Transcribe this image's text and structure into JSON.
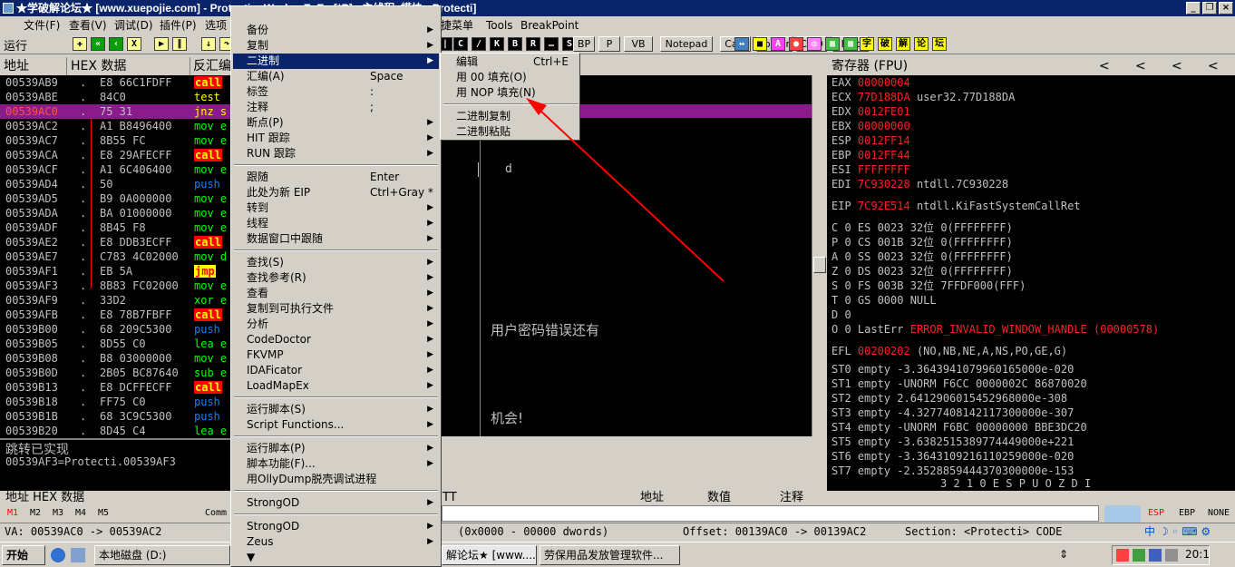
{
  "titlebar": {
    "title": "★学破解论坛★ [www.xuepojie.com] - ProtectionWorker.ExE - [*P] - 主线程, 模块 - Protecti]"
  },
  "menubar": [
    "文件(F)",
    "查看(V)",
    "调试(D)",
    "插件(P)",
    "选项",
    "捷菜单",
    "Tools",
    "BreakPoint"
  ],
  "toolbar": {
    "run_label": "运行",
    "buttons": [
      "BP",
      "P",
      "VB",
      "Notepad",
      "Calc",
      "Folder",
      "CMD",
      "Exit"
    ],
    "icons_right": [
      "破",
      "解",
      "论",
      "坛"
    ]
  },
  "cpu": {
    "headers": [
      "地址",
      "HEX 数据",
      "反汇编"
    ],
    "rows": [
      {
        "addr": "00539AB9",
        "hex": "E8 66C1FDFF",
        "mn": "call",
        "cls": "call",
        "rest": ""
      },
      {
        "addr": "00539ABE",
        "hex": "84C0",
        "mn": "test",
        "cls": "test",
        "rest": ""
      },
      {
        "addr": "00539AC0",
        "hex": "75 31",
        "mn": "jnz s",
        "cls": "jnz",
        "rest": ""
      },
      {
        "addr": "00539AC2",
        "hex": "A1 B8496400",
        "mn": "mov e",
        "cls": "mov",
        "rest": ""
      },
      {
        "addr": "00539AC7",
        "hex": "8B55 FC",
        "mn": "mov e",
        "cls": "mov",
        "rest": ""
      },
      {
        "addr": "00539ACA",
        "hex": "E8 29AFECFF",
        "mn": "call",
        "cls": "call",
        "rest": ""
      },
      {
        "addr": "00539ACF",
        "hex": "A1 6C406400",
        "mn": "mov e",
        "cls": "mov",
        "rest": ""
      },
      {
        "addr": "00539AD4",
        "hex": "50",
        "mn": "push",
        "cls": "push",
        "rest": ""
      },
      {
        "addr": "00539AD5",
        "hex": "B9 0A000000",
        "mn": "mov e",
        "cls": "mov",
        "rest": ""
      },
      {
        "addr": "00539ADA",
        "hex": "BA 01000000",
        "mn": "mov e",
        "cls": "mov",
        "rest": ""
      },
      {
        "addr": "00539ADF",
        "hex": "8B45 F8",
        "mn": "mov e",
        "cls": "mov",
        "rest": ""
      },
      {
        "addr": "00539AE2",
        "hex": "E8 DDB3ECFF",
        "mn": "call",
        "cls": "call",
        "rest": ""
      },
      {
        "addr": "00539AE7",
        "hex": "C783 4C02000",
        "mn": "mov d",
        "cls": "mov",
        "rest": ""
      },
      {
        "addr": "00539AF1",
        "hex": "EB 5A",
        "mn": "jmp",
        "cls": "jmp",
        "rest": ""
      },
      {
        "addr": "00539AF3",
        "hex": "8B83 FC02000",
        "mn": "mov e",
        "cls": "mov",
        "rest": ""
      },
      {
        "addr": "00539AF9",
        "hex": "33D2",
        "mn": "xor e",
        "cls": "xor",
        "rest": ""
      },
      {
        "addr": "00539AFB",
        "hex": "E8 78B7FBFF",
        "mn": "call",
        "cls": "call",
        "rest": ""
      },
      {
        "addr": "00539B00",
        "hex": "68 209C5300",
        "mn": "push",
        "cls": "push",
        "rest": ""
      },
      {
        "addr": "00539B05",
        "hex": "8D55 C0",
        "mn": "lea e",
        "cls": "lea",
        "rest": ""
      },
      {
        "addr": "00539B08",
        "hex": "B8 03000000",
        "mn": "mov e",
        "cls": "mov",
        "rest": ""
      },
      {
        "addr": "00539B0D",
        "hex": "2B05 BC87640",
        "mn": "sub e",
        "cls": "sub",
        "rest": ""
      },
      {
        "addr": "00539B13",
        "hex": "E8 DCFFECFF",
        "mn": "call",
        "cls": "call",
        "rest": ""
      },
      {
        "addr": "00539B18",
        "hex": "FF75 C0",
        "mn": "push",
        "cls": "push",
        "rest": ""
      },
      {
        "addr": "00539B1B",
        "hex": "68 3C9C5300",
        "mn": "push",
        "cls": "push",
        "rest": ""
      },
      {
        "addr": "00539B20",
        "hex": "8D45 C4",
        "mn": "lea e",
        "cls": "lea",
        "rest": ""
      }
    ],
    "info_line1": "跳转已实现",
    "info_line2": "00539AF3=Protecti.00539AF3"
  },
  "dialog": {
    "cursor_text": "d",
    "msg1": "用户密码错误还有",
    "msg2": "机会!"
  },
  "registers": {
    "header": "寄存器 (FPU)",
    "nav": [
      "<",
      "<",
      "<",
      "<"
    ],
    "regs": [
      {
        "n": "EAX",
        "v": "00000004",
        "c": ""
      },
      {
        "n": "ECX",
        "v": "77D188DA",
        "c": "user32.77D188DA"
      },
      {
        "n": "EDX",
        "v": "0012FE01",
        "c": ""
      },
      {
        "n": "EBX",
        "v": "00000000",
        "c": ""
      },
      {
        "n": "ESP",
        "v": "0012FF14",
        "c": ""
      },
      {
        "n": "EBP",
        "v": "0012FF44",
        "c": ""
      },
      {
        "n": "ESI",
        "v": "FFFFFFFF",
        "c": ""
      },
      {
        "n": "EDI",
        "v": "7C930228",
        "c": "ntdll.7C930228"
      }
    ],
    "eip": {
      "n": "EIP",
      "v": "7C92E514",
      "c": "ntdll.KiFastSystemCallRet"
    },
    "flags": [
      "C 0  ES 0023 32位 0(FFFFFFFF)",
      "P 0  CS 001B 32位 0(FFFFFFFF)",
      "A 0  SS 0023 32位 0(FFFFFFFF)",
      "Z 0  DS 0023 32位 0(FFFFFFFF)",
      "S 0  FS 003B 32位 7FFDF000(FFF)",
      "T 0  GS 0000 NULL",
      "D 0"
    ],
    "lasterr_prefix": "O 0  LastErr",
    "lasterr_val": "ERROR_INVALID_WINDOW_HANDLE (00000578)",
    "efl_prefix": "EFL",
    "efl_val": "00200202",
    "efl_rest": "(NO,NB,NE,A,NS,PO,GE,G)",
    "fpu": [
      "ST0 empty -3.3643941079960165000e-020",
      "ST1 empty -UNORM F6CC 0000002C 86870020",
      "ST2 empty 2.6412906015452968000e-308",
      "ST3 empty -4.3277408142117300000e-307",
      "ST4 empty -UNORM F6BC 00000000 BBE3DC20",
      "ST5 empty -3.6382515389774449000e+221",
      "ST6 empty -3.3643109216110259000e-020",
      "ST7 empty -2.3528859444370300000e-153"
    ],
    "fpu_footer": "3 2 1 0      E S P U O Z D I"
  },
  "bottom": {
    "hdr_left": "地址    HEX 数据",
    "hdr_mid": "TT",
    "hdr_right": [
      "地址",
      "数值",
      "注释"
    ],
    "mtabs": [
      "M1",
      "M2",
      "M3",
      "M4",
      "M5"
    ],
    "comm": "Comm",
    "stack_tabs": [
      "ESP",
      "EBP",
      "NONE"
    ]
  },
  "status": {
    "va": "VA: 00539AC0 -> 00539AC2",
    "dwords": "(0x0000 - 00000 dwords)",
    "offset": "Offset: 00139AC0 -> 00139AC2",
    "section": "Section: <Protecti> CODE"
  },
  "taskbar": {
    "start": "开始",
    "items": [
      "本地磁盘 (D:)",
      "解论坛★ [www....",
      "劳保用品发放管理软件..."
    ],
    "clock": "20:1"
  },
  "context_menu": {
    "items": [
      {
        "label": "备份",
        "sc": "",
        "arrow": true
      },
      {
        "label": "复制",
        "sc": "",
        "arrow": true
      },
      {
        "label": "二进制",
        "sc": "",
        "arrow": true,
        "hl": true
      },
      {
        "label": "汇编(A)",
        "sc": "Space",
        "arrow": false
      },
      {
        "label": "标签",
        "sc": ":",
        "arrow": false
      },
      {
        "label": "注释",
        "sc": ";",
        "arrow": false
      },
      {
        "label": "断点(P)",
        "sc": "",
        "arrow": true
      },
      {
        "label": "HIT 跟踪",
        "sc": "",
        "arrow": true
      },
      {
        "label": "RUN 跟踪",
        "sc": "",
        "arrow": true
      },
      {
        "sep": true
      },
      {
        "label": "跟随",
        "sc": "Enter",
        "arrow": false
      },
      {
        "label": "此处为新 EIP",
        "sc": "Ctrl+Gray *",
        "arrow": false
      },
      {
        "label": "转到",
        "sc": "",
        "arrow": true
      },
      {
        "label": "线程",
        "sc": "",
        "arrow": true
      },
      {
        "label": "数据窗口中跟随",
        "sc": "",
        "arrow": true
      },
      {
        "sep": true
      },
      {
        "label": "查找(S)",
        "sc": "",
        "arrow": true
      },
      {
        "label": "查找参考(R)",
        "sc": "",
        "arrow": true
      },
      {
        "label": "查看",
        "sc": "",
        "arrow": true
      },
      {
        "label": "复制到可执行文件",
        "sc": "",
        "arrow": true
      },
      {
        "label": "分析",
        "sc": "",
        "arrow": true
      },
      {
        "label": "CodeDoctor",
        "sc": "",
        "arrow": true
      },
      {
        "label": "FKVMP",
        "sc": "",
        "arrow": true
      },
      {
        "label": "IDAFicator",
        "sc": "",
        "arrow": true
      },
      {
        "label": "LoadMapEx",
        "sc": "",
        "arrow": true
      },
      {
        "sep": true
      },
      {
        "label": "运行脚本(S)",
        "sc": "",
        "arrow": true
      },
      {
        "label": "Script Functions...",
        "sc": "",
        "arrow": true
      },
      {
        "sep": true
      },
      {
        "label": "运行脚本(P)",
        "sc": "",
        "arrow": true
      },
      {
        "label": "脚本功能(F)...",
        "sc": "",
        "arrow": true
      },
      {
        "label": "用OllyDump脱壳调试进程",
        "sc": "",
        "arrow": false
      },
      {
        "sep": true
      },
      {
        "label": "StrongOD",
        "sc": "",
        "arrow": true
      },
      {
        "sep": true
      },
      {
        "label": "StrongOD",
        "sc": "",
        "arrow": true
      },
      {
        "label": "Zeus",
        "sc": "",
        "arrow": true
      },
      {
        "label": "▼",
        "sc": "",
        "arrow": false
      }
    ]
  },
  "submenu": {
    "items": [
      {
        "label": "编辑",
        "sc": "Ctrl+E"
      },
      {
        "label": "用 00 填充(O)",
        "sc": ""
      },
      {
        "label": "用 NOP 填充(N)",
        "sc": ""
      },
      {
        "sep": true
      },
      {
        "label": "二进制复制",
        "sc": ""
      },
      {
        "label": "二进制粘贴",
        "sc": ""
      }
    ]
  },
  "colors": {
    "accent": "#ff0000",
    "selected": "#8b1a8b",
    "menu_highlight": "#0a246a"
  }
}
